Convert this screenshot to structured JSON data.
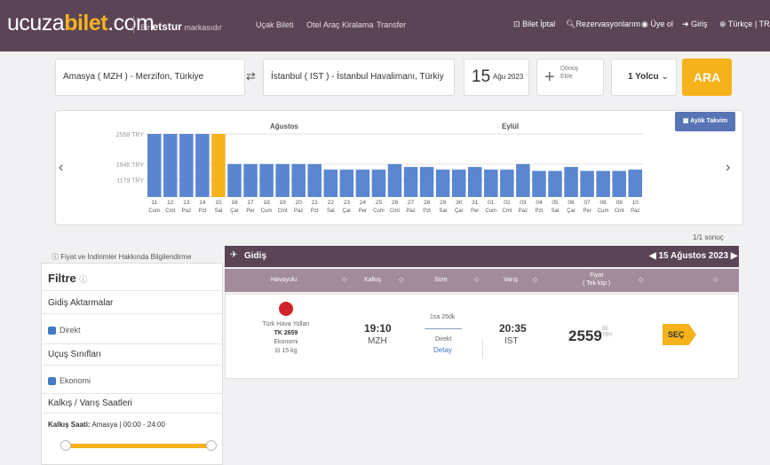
{
  "header": {
    "logo": {
      "part1": "ucuza",
      "part2": "bilet",
      "part3": ".com"
    },
    "brand_prefix": "Bir",
    "brand_name": "etstur",
    "brand_suffix": "markasıdır",
    "nav": [
      "Uçak Bileti",
      "Otel",
      "Araç Kiralama",
      "Transfer"
    ],
    "right": {
      "bilet_iptal": "Bilet İptal",
      "rezervasyonlarim": "Rezervasyonlarım",
      "uye_ol": "Üye ol",
      "giris": "Giriş",
      "dil": "Türkçe | TR"
    }
  },
  "search": {
    "from": "Amasya ( MZH ) - Merzifon, Türkiye",
    "to": "İstanbul ( IST ) - İstanbul Havalimanı, Türkiy",
    "date_day": "15",
    "date_month": "Ağu 2023",
    "return_line1": "Dönüş",
    "return_line2": "Ekle",
    "passengers": "1 Yolcu",
    "submit": "ARA"
  },
  "calendar": {
    "month1": "Ağustos",
    "month2": "Eylül",
    "monthly_button": "Aylık Takvim",
    "selected_index": 4,
    "colors": {
      "bar": "#5a86cf",
      "selected": "#f6b21b",
      "grid": "#e3e3e3"
    }
  },
  "chart_data": {
    "type": "bar",
    "ytick_labels": [
      "2558 TRY",
      "1646 TRY",
      "1179 TRY"
    ],
    "ytick_values": [
      2558,
      1646,
      1179
    ],
    "ylim": [
      650,
      2558
    ],
    "days": [
      "11",
      "12",
      "13",
      "14",
      "15",
      "16",
      "17",
      "18",
      "19",
      "20",
      "21",
      "22",
      "23",
      "24",
      "25",
      "26",
      "27",
      "28",
      "29",
      "30",
      "31",
      "01",
      "02",
      "03",
      "04",
      "05",
      "06",
      "07",
      "08",
      "09",
      "10"
    ],
    "weekdays": [
      "Cum",
      "Cmt",
      "Paz",
      "Pzt",
      "Sal",
      "Çar",
      "Per",
      "Cum",
      "Cmt",
      "Paz",
      "Pzt",
      "Sal",
      "Çar",
      "Per",
      "Cum",
      "Cmt",
      "Paz",
      "Pzt",
      "Sal",
      "Çar",
      "Per",
      "Cum",
      "Cmt",
      "Paz",
      "Pzt",
      "Sal",
      "Çar",
      "Per",
      "Cum",
      "Cmt",
      "Paz"
    ],
    "values": [
      2558,
      2558,
      2558,
      2558,
      2559,
      1646,
      1646,
      1646,
      1646,
      1646,
      1646,
      1480,
      1480,
      1480,
      1480,
      1646,
      1560,
      1560,
      1480,
      1480,
      1560,
      1480,
      1480,
      1646,
      1440,
      1440,
      1560,
      1440,
      1440,
      1440,
      1480
    ]
  },
  "left": {
    "info": "Fiyat ve İndirimler Hakkında Bilgilendirme",
    "filter_title": "Filtre",
    "aktarma_title": "Gidiş Aktarmalar",
    "direkt": "Direkt",
    "sinif_title": "Uçuş Sınıfları",
    "ekonomi": "Ekonomi",
    "saat_title": "Kalkış / Varış Saatleri",
    "kalkis_label": "Kalkış Saati:",
    "kalkis_value": "Amasya | 00:00 - 24:00"
  },
  "results": {
    "count": "1/1  sonuç",
    "direction": "Gidiş",
    "date": "15 Ağustos 2023",
    "columns": [
      "Havayolu",
      "Kalkış",
      "Süre",
      "Varış",
      "Fiyat",
      "( Tek kişi )"
    ],
    "flight": {
      "airline": "Türk Hava Yolları",
      "code": "TK 2659",
      "class": "Ekonomi",
      "baggage": "15 kg",
      "dep_time": "19:10",
      "dep_airport": "MZH",
      "duration": "1sa 25dk",
      "stops": "Direkt",
      "detail": "Detay",
      "arr_time": "20:35",
      "arr_airport": "IST",
      "price": "2559",
      "price_cents": "00",
      "currency": "TRY",
      "select": "SEÇ"
    }
  }
}
